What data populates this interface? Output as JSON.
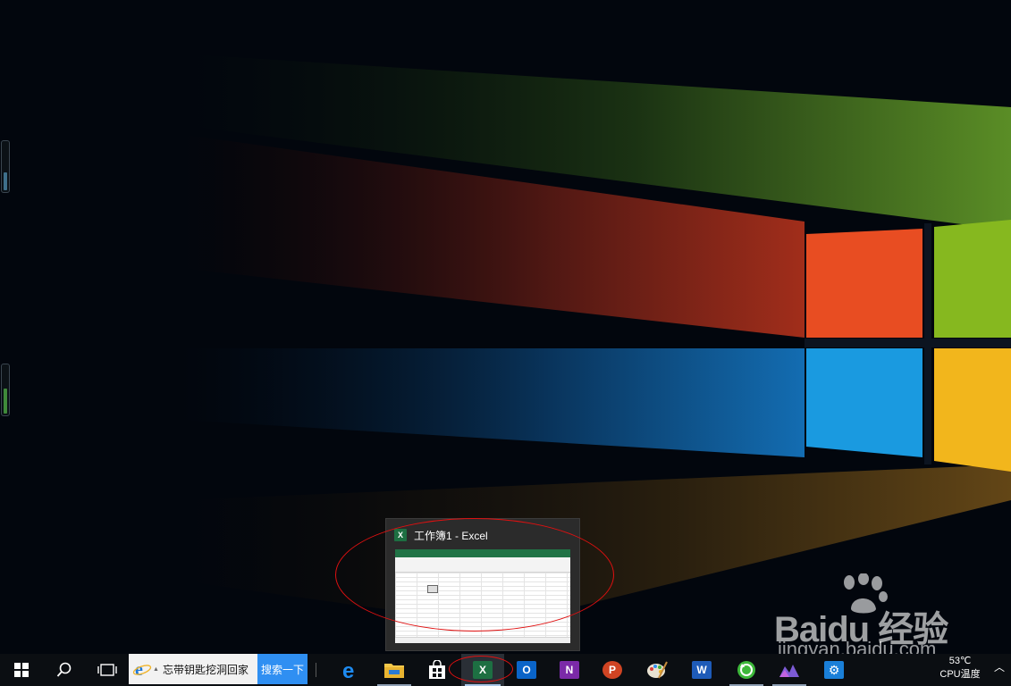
{
  "preview": {
    "app_icon_label": "X",
    "title": "工作簿1 - Excel"
  },
  "taskbar": {
    "search_text": "忘带钥匙挖洞回家",
    "search_button": "搜索一下",
    "apps": [
      {
        "name": "edge",
        "label": "e"
      },
      {
        "name": "file-explorer",
        "label": ""
      },
      {
        "name": "store",
        "label": ""
      },
      {
        "name": "excel",
        "label": "X"
      },
      {
        "name": "outlook",
        "label": "O"
      },
      {
        "name": "onenote",
        "label": "N"
      },
      {
        "name": "powerpoint",
        "label": "P"
      },
      {
        "name": "paint",
        "label": ""
      },
      {
        "name": "word",
        "label": "W"
      },
      {
        "name": "360",
        "label": ""
      },
      {
        "name": "media-app",
        "label": ""
      },
      {
        "name": "settings",
        "label": "⚙"
      }
    ],
    "tray": {
      "temperature": "53℃",
      "temperature_label": "CPU温度"
    }
  },
  "watermark": {
    "brand": "Baidu 经验",
    "url": "jingyan.baidu.com"
  },
  "colors": {
    "excel_green": "#1d6f42",
    "annotation_red": "#e01010",
    "search_button_blue": "#2f8ff2"
  }
}
